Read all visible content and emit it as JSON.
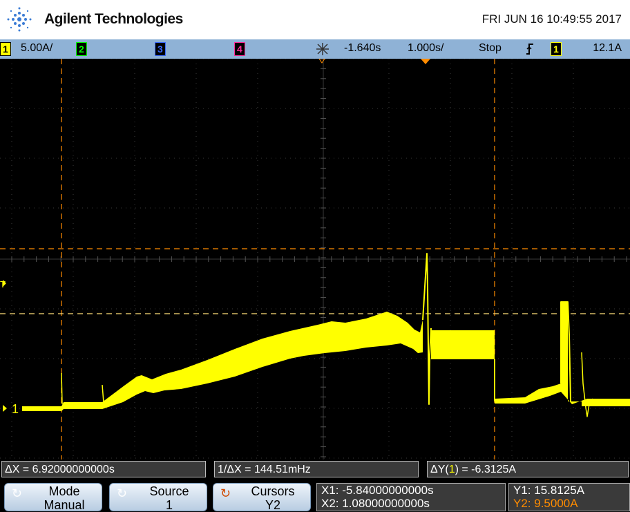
{
  "header": {
    "brand": "Agilent Technologies",
    "datetime": "FRI JUN 16 10:49:55 2017"
  },
  "status": {
    "ch1_num": "1",
    "ch1_scale": "5.00A/",
    "ch2_num": "2",
    "ch3_num": "3",
    "ch4_num": "4",
    "trigger_time": "-1.640s",
    "timebase": "1.000s/",
    "run_state": "Stop",
    "slope_icon": "rising-edge",
    "trig_ch": "1",
    "trig_level": "12.1A",
    "colors": {
      "ch1": "#ffff00",
      "ch2": "#00ff00",
      "ch3": "#3b6bff",
      "ch4": "#ff2d9b"
    }
  },
  "screen": {
    "ch1_label": "1",
    "trigger_marker": "T",
    "trace_color": "#ffff00",
    "cursor_color": "#ff8c00"
  },
  "measurements": {
    "delta_x": "ΔX = 6.92000000000s",
    "inv_delta_x": "1/ΔX = 144.51mHz",
    "delta_y_pre": "ΔY(",
    "delta_y_ch": "1",
    "delta_y_post": ") = -6.3125A"
  },
  "softkeys": {
    "mode_label": "Mode",
    "mode_value": "Manual",
    "source_label": "Source",
    "source_value": "1",
    "cursors_label": "Cursors",
    "cursors_value": "Y2"
  },
  "readouts": {
    "x1": "X1: -5.84000000000s",
    "x2": "X2: 1.08000000000s",
    "y1": "Y1: 15.8125A",
    "y2": "Y2: 9.5000A"
  }
}
